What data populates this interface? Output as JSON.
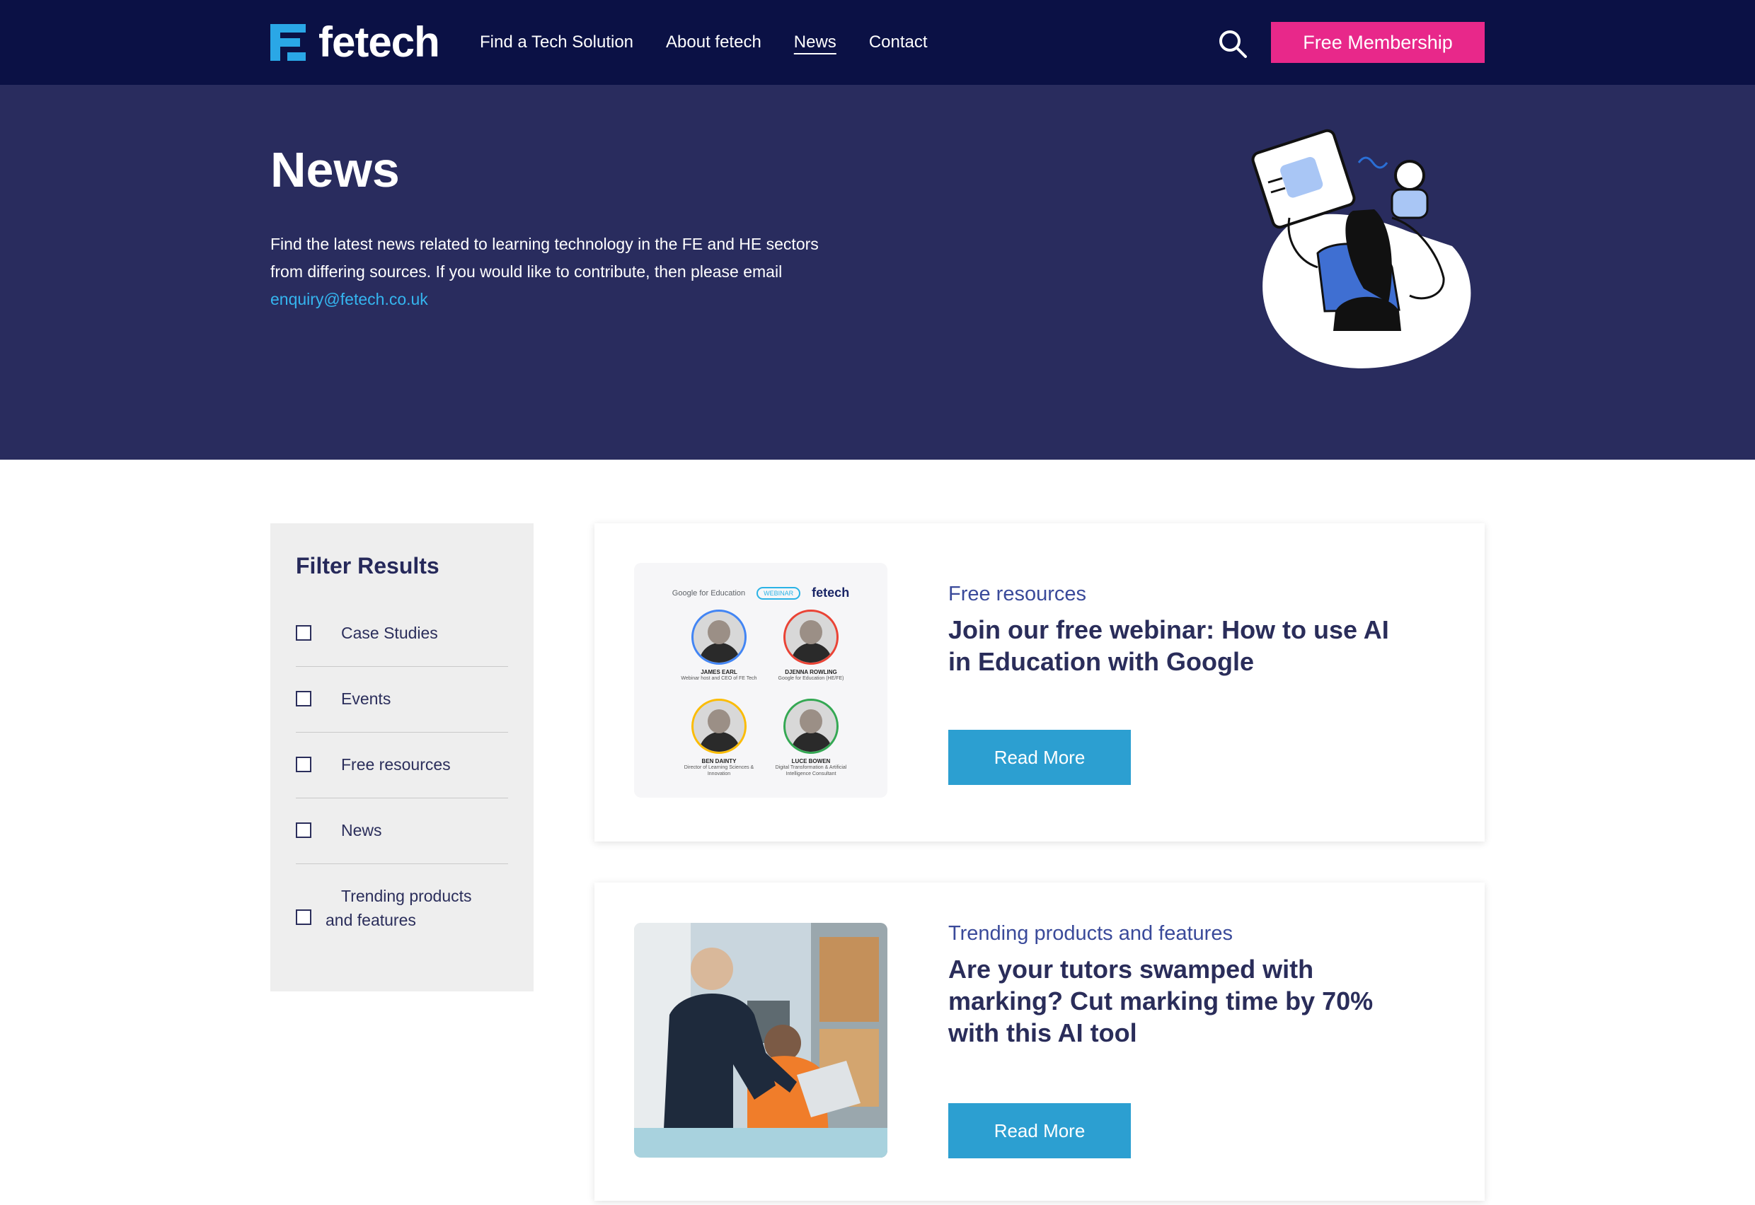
{
  "header": {
    "logo_text": "fetech",
    "nav": [
      "Find a Tech Solution",
      "About fetech",
      "News",
      "Contact"
    ],
    "active_nav": "News",
    "cta_label": "Free Membership",
    "brand_colors": {
      "navy": "#0b1145",
      "pink": "#e8288a",
      "blue": "#2aa7e6"
    }
  },
  "hero": {
    "title": "News",
    "description": "Find the latest news related to learning technology in the FE and HE sectors from differing sources. If you would like to contribute, then please email ",
    "email": "enquiry@fetech.co.uk"
  },
  "filter": {
    "title": "Filter Results",
    "options": [
      "Case Studies",
      "Events",
      "Free resources",
      "News",
      "Trending products and features"
    ]
  },
  "articles": [
    {
      "category": "Free resources",
      "title": "Join our free webinar: How to use AI in Education with Google",
      "button": "Read More",
      "thumbnail": {
        "header_left": "Google for Education",
        "badge": "WEBINAR",
        "brand": "fetech",
        "speakers": [
          {
            "name": "JAMES EARL",
            "role": "Webinar host and CEO of FE Tech"
          },
          {
            "name": "DJENNA ROWLING",
            "role": "Google for Education (HE/FE)"
          },
          {
            "name": "BEN DAINTY",
            "role": "Director of Learning Sciences & Innovation"
          },
          {
            "name": "LUCE BOWEN",
            "role": "Digital Transformation & Artificial Intelligence Consultant"
          }
        ]
      }
    },
    {
      "category": "Trending products and features",
      "title": "Are your tutors swamped with marking? Cut marking time by 70% with this AI tool",
      "button": "Read More"
    }
  ]
}
